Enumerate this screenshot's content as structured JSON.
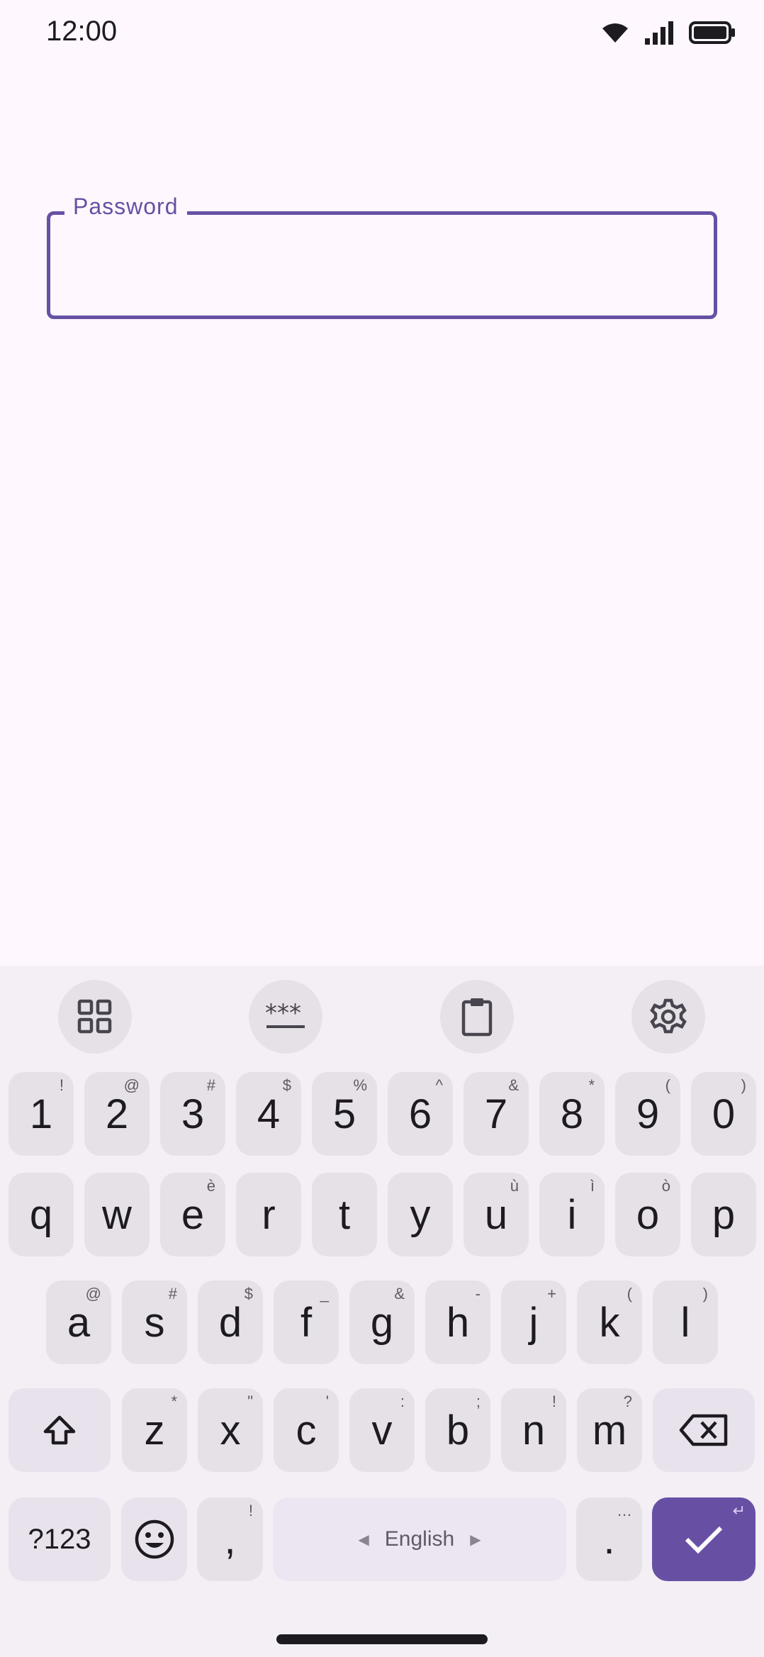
{
  "status_bar": {
    "time": "12:00",
    "icons": [
      "wifi-icon",
      "cell-signal-icon",
      "battery-icon"
    ]
  },
  "password_field": {
    "label": "Password",
    "value": ""
  },
  "keyboard": {
    "toolbar": [
      "apps-grid-icon",
      "password-dots-icon",
      "clipboard-icon",
      "settings-gear-icon"
    ],
    "number_row": [
      {
        "key": "1",
        "hint": "!"
      },
      {
        "key": "2",
        "hint": "@"
      },
      {
        "key": "3",
        "hint": "#"
      },
      {
        "key": "4",
        "hint": "$"
      },
      {
        "key": "5",
        "hint": "%"
      },
      {
        "key": "6",
        "hint": "^"
      },
      {
        "key": "7",
        "hint": "&"
      },
      {
        "key": "8",
        "hint": "*"
      },
      {
        "key": "9",
        "hint": "("
      },
      {
        "key": "0",
        "hint": ")"
      }
    ],
    "row1": [
      {
        "key": "q",
        "hint": ""
      },
      {
        "key": "w",
        "hint": ""
      },
      {
        "key": "e",
        "hint": "è"
      },
      {
        "key": "r",
        "hint": ""
      },
      {
        "key": "t",
        "hint": ""
      },
      {
        "key": "y",
        "hint": ""
      },
      {
        "key": "u",
        "hint": "ù"
      },
      {
        "key": "i",
        "hint": "ì"
      },
      {
        "key": "o",
        "hint": "ò"
      },
      {
        "key": "p",
        "hint": ""
      }
    ],
    "row2": [
      {
        "key": "a",
        "hint": "@"
      },
      {
        "key": "s",
        "hint": "#"
      },
      {
        "key": "d",
        "hint": "$"
      },
      {
        "key": "f",
        "hint": "_"
      },
      {
        "key": "g",
        "hint": "&"
      },
      {
        "key": "h",
        "hint": "-"
      },
      {
        "key": "j",
        "hint": "+"
      },
      {
        "key": "k",
        "hint": "("
      },
      {
        "key": "l",
        "hint": ")"
      }
    ],
    "row3": [
      {
        "key": "z",
        "hint": "*"
      },
      {
        "key": "x",
        "hint": "\""
      },
      {
        "key": "c",
        "hint": "'"
      },
      {
        "key": "v",
        "hint": ":"
      },
      {
        "key": "b",
        "hint": ";"
      },
      {
        "key": "n",
        "hint": "!"
      },
      {
        "key": "m",
        "hint": "?"
      }
    ],
    "bottom": {
      "symbols_label": "?123",
      "comma": ",",
      "comma_hint": "!",
      "space_label": "English",
      "period": ".",
      "period_hint": "…"
    },
    "accent_color": "#6750a4"
  }
}
